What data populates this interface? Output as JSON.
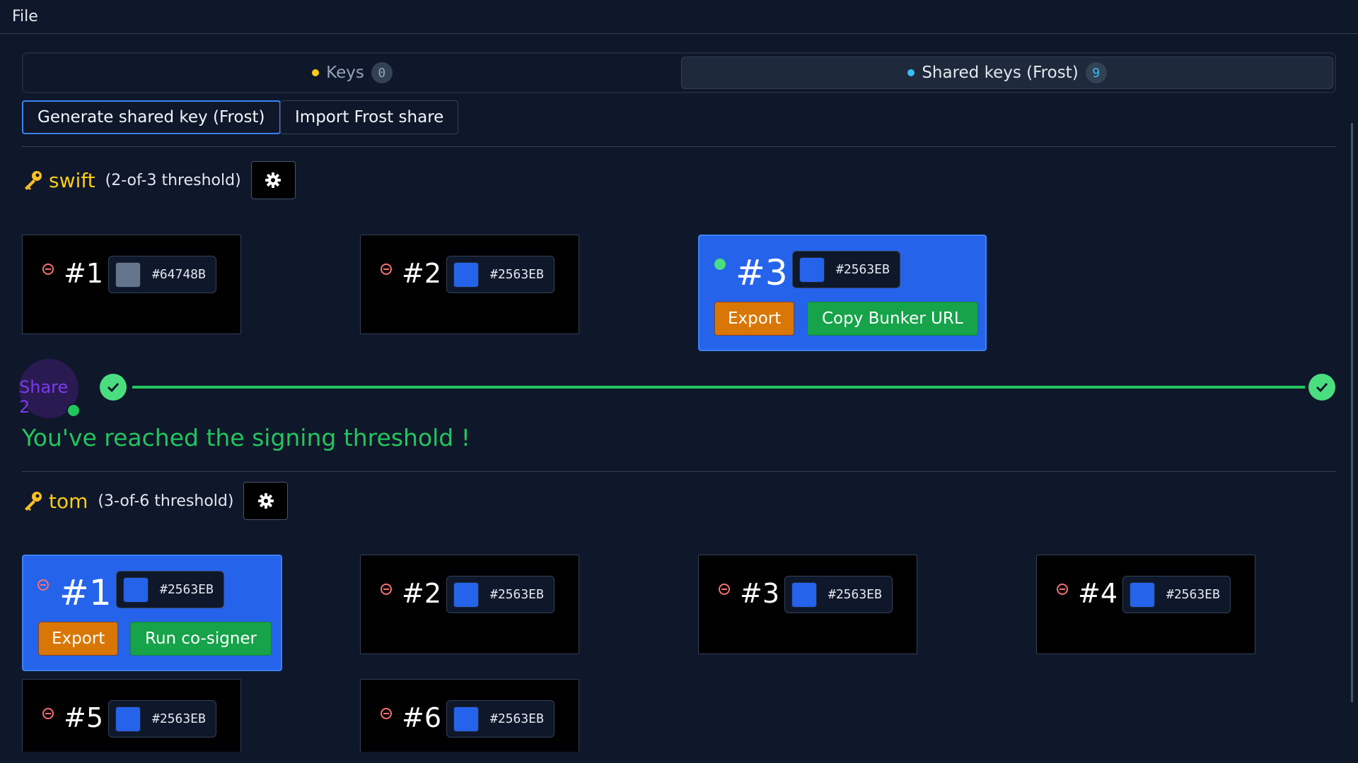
{
  "menu": {
    "file": "File"
  },
  "tabs": [
    {
      "label": "Keys",
      "count": "0"
    },
    {
      "label": "Shared keys (Frost)",
      "count": "9"
    }
  ],
  "actions": {
    "generate": "Generate shared key (Frost)",
    "import": "Import Frost share"
  },
  "keys": [
    {
      "name": "swift",
      "threshold": "(2-of-3 threshold)",
      "shares": [
        {
          "num": "#1",
          "color": "#64748B"
        },
        {
          "num": "#2",
          "color": "#2563EB"
        },
        {
          "num": "#3",
          "color": "#2563EB",
          "export": "Export",
          "action": "Copy Bunker URL"
        }
      ],
      "progress": {
        "share_label": "Share 2",
        "message": "You've reached the signing threshold !"
      }
    },
    {
      "name": "tom",
      "threshold": "(3-of-6 threshold)",
      "shares": [
        {
          "num": "#1",
          "color": "#2563EB",
          "export": "Export",
          "action": "Run co-signer"
        },
        {
          "num": "#2",
          "color": "#2563EB"
        },
        {
          "num": "#3",
          "color": "#2563EB"
        },
        {
          "num": "#4",
          "color": "#2563EB"
        },
        {
          "num": "#5",
          "color": "#2563EB"
        },
        {
          "num": "#6",
          "color": "#2563EB"
        }
      ]
    }
  ],
  "colors": {
    "background": "#0f172a",
    "accent": "#2563eb",
    "key_name": "#facc15",
    "success": "#22c55e",
    "export": "#d97706"
  },
  "icons": {
    "key": "key-icon",
    "settings": "gear-icon",
    "remove": "minus-circle-icon",
    "check": "check-circle-icon"
  }
}
